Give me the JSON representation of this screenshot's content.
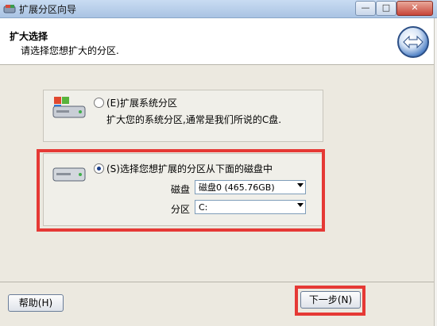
{
  "window": {
    "title": "扩展分区向导",
    "min_glyph": "—",
    "max_glyph": "□",
    "close_glyph": "✕"
  },
  "header": {
    "title": "扩大选择",
    "subtitle": "请选择您想扩大的分区."
  },
  "options": [
    {
      "label": "(E)扩展系统分区",
      "description": "扩大您的系统分区,通常是我们所说的C盘.",
      "selected": false
    },
    {
      "label": "(S)选择您想扩展的分区从下面的磁盘中",
      "selected": true,
      "disk_label": "磁盘",
      "disk_value": "磁盘0 (465.76GB)",
      "partition_label": "分区",
      "partition_value": "C:"
    }
  ],
  "buttons": {
    "help": "帮助(H)",
    "next": "下一步(N)"
  },
  "colors": {
    "highlight": "#e53935",
    "header_bg": "#ffffff",
    "body_bg": "#ece9e0"
  }
}
